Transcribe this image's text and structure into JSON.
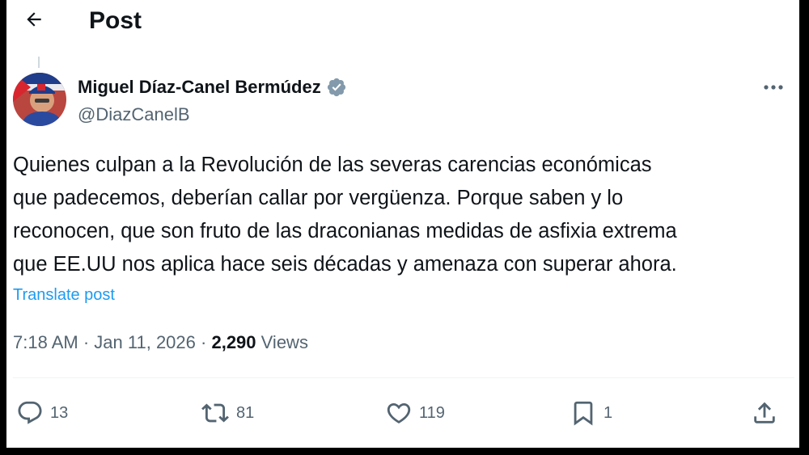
{
  "header": {
    "title": "Post"
  },
  "author": {
    "name": "Miguel Díaz-Canel Bermúdez",
    "handle": "@DiazCanelB",
    "verified": true
  },
  "post": {
    "text": "Quienes culpan a la Revolución de las severas carencias económicas\nque padecemos, deberían callar por vergüenza. Porque saben y lo\nreconocen, que son fruto de las draconianas medidas de asfixia extrema\nque EE.UU nos aplica hace seis décadas y amenaza con superar ahora.",
    "translate_label": "Translate post"
  },
  "meta": {
    "time": "7:18 AM",
    "separator": "·",
    "date": "Jan 11, 2026",
    "views_count": "2,290",
    "views_label": "Views"
  },
  "actions": {
    "replies": "13",
    "reposts": "81",
    "likes": "119",
    "bookmarks": "1"
  },
  "colors": {
    "accent": "#1d9bf0",
    "secondary_text": "#536471",
    "verified_badge": "#829aab"
  },
  "icons": {
    "back": "arrow-left-icon",
    "verified": "verified-badge-icon",
    "more": "more-horizontal-icon",
    "reply": "reply-icon",
    "repost": "repost-icon",
    "like": "heart-icon",
    "bookmark": "bookmark-icon",
    "share": "share-icon"
  }
}
